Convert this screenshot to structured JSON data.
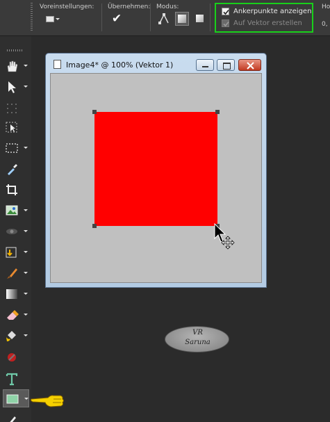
{
  "toolbar": {
    "presets_label": "Voreinstellungen:",
    "apply_label": "Übernehmen:",
    "mode_label": "Modus:",
    "show_anchor_points_label": "Ankerpunkte anzeigen",
    "show_anchor_points_checked": true,
    "create_on_vector_label": "Auf Vektor erstellen",
    "create_on_vector_checked": true,
    "create_on_vector_disabled": true,
    "cut_label": "Ho",
    "cut_value": "0,"
  },
  "image_window": {
    "title": "Image4* @ 100% (Vektor 1)"
  },
  "canvas": {
    "shape_color": "#ff0000",
    "background_color": "#c0c0c0"
  },
  "tools": [
    {
      "icon": "pan-hand-icon"
    },
    {
      "icon": "pick-arrow-icon"
    },
    {
      "icon": "dotted-select-icon"
    },
    {
      "icon": "object-select-icon"
    },
    {
      "icon": "selection-rect-icon"
    },
    {
      "icon": "dropper-icon"
    },
    {
      "icon": "crop-icon"
    },
    {
      "icon": "image-icon"
    },
    {
      "icon": "eye-icon"
    },
    {
      "icon": "clone-brush-icon"
    },
    {
      "icon": "paint-brush-icon"
    },
    {
      "icon": "gradient-icon"
    },
    {
      "icon": "eraser-icon"
    },
    {
      "icon": "fill-icon"
    },
    {
      "icon": "retouch-icon"
    },
    {
      "icon": "text-icon"
    },
    {
      "icon": "rectangle-shape-icon"
    },
    {
      "icon": "pen-icon"
    }
  ],
  "watermark": {
    "line1": "VR",
    "line2": "Saruna"
  },
  "colors": {
    "highlight": "#18d01a",
    "pointer_hand": "#f5d000"
  }
}
